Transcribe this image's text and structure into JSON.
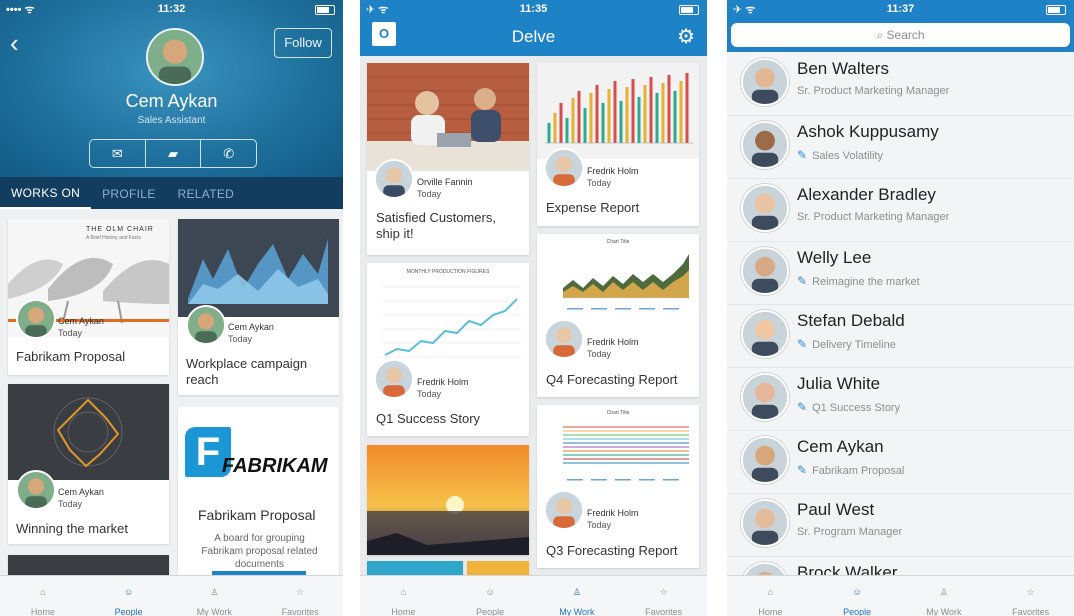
{
  "profile": {
    "time": "11:32",
    "name": "Cem Aykan",
    "role": "Sales Assistant",
    "follow_label": "Follow",
    "tabs": [
      "WORKS ON",
      "PROFILE",
      "RELATED"
    ],
    "thumb_texts": {
      "olm_brand": "THE OLM CHAIR",
      "olm_tagline": "A Brief History and Facts",
      "fabrikam_logo": "FABRIKAM"
    },
    "cards": [
      {
        "title": "Fabrikam Proposal",
        "person": "Cem  Aykan",
        "date": "Today"
      },
      {
        "title": "Workplace campaign reach",
        "person": "Cem  Aykan",
        "date": "Today"
      },
      {
        "title": "Winning the market",
        "person": "Cem  Aykan",
        "date": "Today"
      },
      {
        "title": "Fabrikam Proposal",
        "description": "A board for grouping Fabrikam proposal related documents"
      }
    ]
  },
  "delve": {
    "time": "11:35",
    "app_title": "Delve",
    "chart_captions": {
      "monthly": "MONTHLY PRODUCTION FIGURES",
      "chart_title": "Chart Title"
    },
    "cards": [
      {
        "title": "Satisfied Customers, ship it!",
        "person": "Orville Fannin",
        "date": "Today"
      },
      {
        "title": "Expense Report",
        "person": "Fredrik Holm",
        "date": "Today"
      },
      {
        "title": "Q1 Success Story",
        "person": "Fredrik Holm",
        "date": "Today"
      },
      {
        "title": "Q4 Forecasting Report",
        "person": "Fredrik Holm",
        "date": "Today"
      },
      {
        "title": "Q3 Forecasting Report",
        "person": "Fredrik Holm",
        "date": "Today"
      }
    ]
  },
  "people": {
    "time": "11:37",
    "search_placeholder": "Search",
    "list": [
      {
        "name": "Ben Walters",
        "sub": "Sr. Product Marketing Manager",
        "doc": false
      },
      {
        "name": "Ashok Kuppusamy",
        "sub": "Sales Volatility",
        "doc": true
      },
      {
        "name": "Alexander Bradley",
        "sub": "Sr. Product Marketing Manager",
        "doc": false
      },
      {
        "name": "Welly Lee",
        "sub": "Reimagine the market",
        "doc": true
      },
      {
        "name": "Stefan Debald",
        "sub": "Delivery Timeline",
        "doc": true
      },
      {
        "name": "Julia White",
        "sub": "Q1 Success Story",
        "doc": true
      },
      {
        "name": "Cem Aykan",
        "sub": "Fabrikam Proposal",
        "doc": true
      },
      {
        "name": "Paul West",
        "sub": "Sr. Program Manager",
        "doc": false
      },
      {
        "name": "Brock Walker",
        "sub": "",
        "doc": false
      }
    ]
  },
  "tabbar": [
    "Home",
    "People",
    "My Work",
    "Favorites"
  ],
  "colors": {
    "accent": "#1f82c6",
    "active_tab": "#1f73c4",
    "dark_tabs": "#133d5e"
  }
}
